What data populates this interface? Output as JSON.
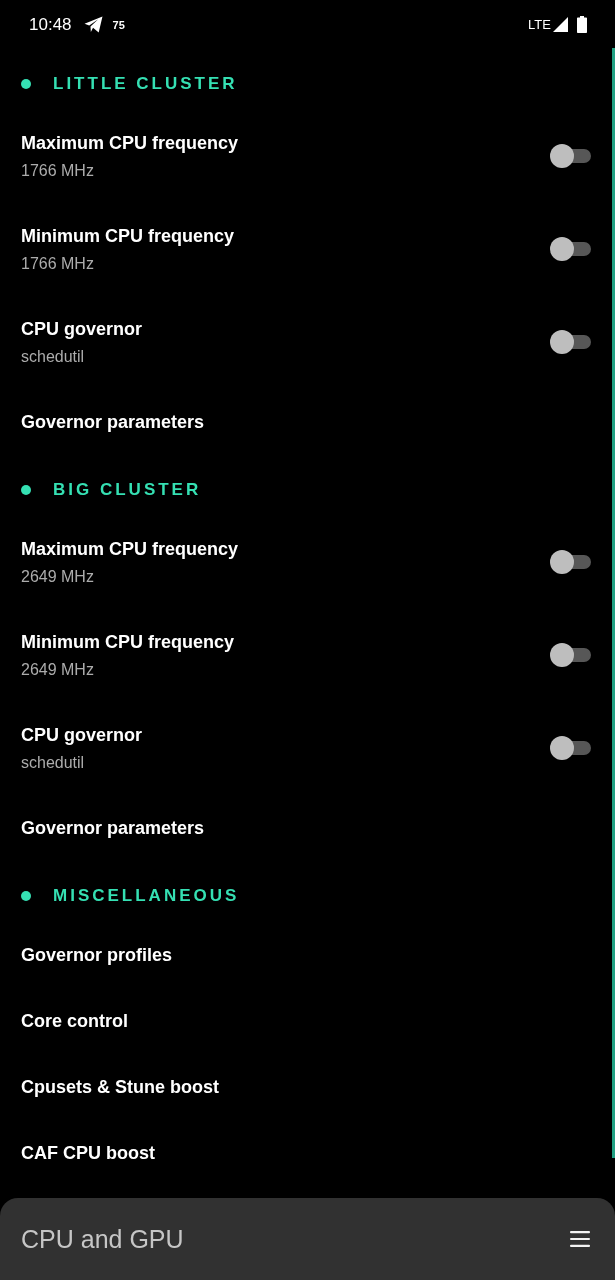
{
  "status_bar": {
    "time": "10:48",
    "notification_count": "75",
    "network": "LTE"
  },
  "sections": [
    {
      "title": "LITTLE CLUSTER",
      "items": [
        {
          "kind": "switch",
          "title": "Maximum CPU frequency",
          "value": "1766 MHz",
          "checked": false
        },
        {
          "kind": "switch",
          "title": "Minimum CPU frequency",
          "value": "1766 MHz",
          "checked": false
        },
        {
          "kind": "switch",
          "title": "CPU governor",
          "value": "schedutil",
          "checked": false
        },
        {
          "kind": "plain",
          "title": "Governor parameters"
        }
      ]
    },
    {
      "title": "BIG CLUSTER",
      "items": [
        {
          "kind": "switch",
          "title": "Maximum CPU frequency",
          "value": "2649 MHz",
          "checked": false
        },
        {
          "kind": "switch",
          "title": "Minimum CPU frequency",
          "value": "2649 MHz",
          "checked": false
        },
        {
          "kind": "switch",
          "title": "CPU governor",
          "value": "schedutil",
          "checked": false
        },
        {
          "kind": "plain",
          "title": "Governor parameters"
        }
      ]
    },
    {
      "title": "MISCELLANEOUS",
      "items": [
        {
          "kind": "plain",
          "title": "Governor profiles"
        },
        {
          "kind": "plain",
          "title": "Core control"
        },
        {
          "kind": "plain",
          "title": "Cpusets & Stune boost"
        },
        {
          "kind": "plain",
          "title": "CAF CPU boost"
        }
      ]
    }
  ],
  "bottom_bar": {
    "title": "CPU and GPU"
  }
}
